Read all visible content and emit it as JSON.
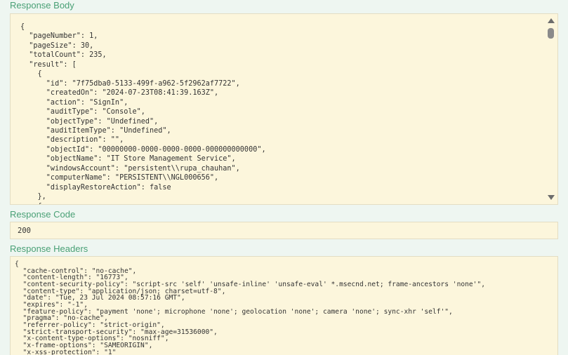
{
  "response_body": {
    "title": "Response Body",
    "lines": [
      "{",
      "  \"pageNumber\": 1,",
      "  \"pageSize\": 30,",
      "  \"totalCount\": 235,",
      "  \"result\": [",
      "    {",
      "      \"id\": \"7f75dba0-5133-499f-a962-5f2962af7722\",",
      "      \"createdOn\": \"2024-07-23T08:41:39.163Z\",",
      "      \"action\": \"SignIn\",",
      "      \"auditType\": \"Console\",",
      "      \"objectType\": \"Undefined\",",
      "      \"auditItemType\": \"Undefined\",",
      "      \"description\": \"\",",
      "      \"objectId\": \"00000000-0000-0000-0000-000000000000\",",
      "      \"objectName\": \"IT Store Management Service\",",
      "      \"windowsAccount\": \"persistent\\\\rupa_chauhan\",",
      "      \"computerName\": \"PERSISTENT\\\\NGL000656\",",
      "      \"displayRestoreAction\": false",
      "    },",
      "    {"
    ]
  },
  "response_code": {
    "title": "Response Code",
    "value": "200"
  },
  "response_headers": {
    "title": "Response Headers",
    "lines": [
      "{",
      "  \"cache-control\": \"no-cache\",",
      "  \"content-length\": \"16773\",",
      "  \"content-security-policy\": \"script-src 'self' 'unsafe-inline' 'unsafe-eval' *.msecnd.net; frame-ancestors 'none'\",",
      "  \"content-type\": \"application/json; charset=utf-8\",",
      "  \"date\": \"Tue, 23 Jul 2024 08:57:16 GMT\",",
      "  \"expires\": \"-1\",",
      "  \"feature-policy\": \"payment 'none'; microphone 'none'; geolocation 'none'; camera 'none'; sync-xhr 'self'\",",
      "  \"pragma\": \"no-cache\",",
      "  \"referrer-policy\": \"strict-origin\",",
      "  \"strict-transport-security\": \"max-age=31536000\",",
      "  \"x-content-type-options\": \"nosniff\",",
      "  \"x-frame-options\": \"SAMEORIGIN\",",
      "  \"x-xss-protection\": \"1\"",
      "}"
    ]
  },
  "colors": {
    "title": "#49a075",
    "box_background": "#fcf6dc",
    "page_background": "#eef6f1"
  },
  "icons": {
    "scroll_up": "scroll-up-arrow-icon",
    "scroll_down": "scroll-down-arrow-icon"
  }
}
